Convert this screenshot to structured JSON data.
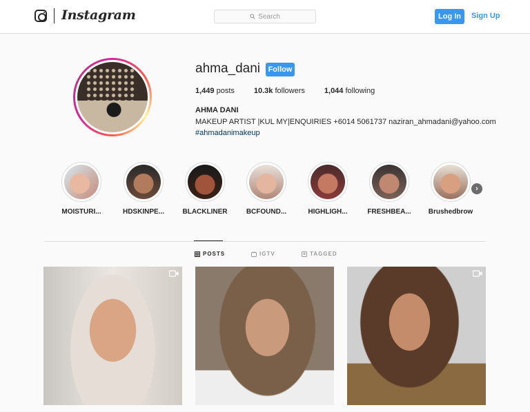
{
  "header": {
    "brand": "Instagram",
    "search_placeholder": "Search",
    "login_label": "Log In",
    "signup_label": "Sign Up"
  },
  "profile": {
    "username": "ahma_dani",
    "follow_label": "Follow",
    "stats": {
      "posts_count": "1,449",
      "posts_label": "posts",
      "followers_count": "10.3k",
      "followers_label": "followers",
      "following_count": "1,044",
      "following_label": "following"
    },
    "full_name": "AHMA DANI",
    "bio": "MAKEUP ARTIST |KUL MY|ENQUIRIES +6014 5061737 naziran_ahmadani@yahoo.com",
    "hashtag": "#ahmadanimakeup"
  },
  "highlights": [
    {
      "label": "MOISTURI..."
    },
    {
      "label": "HDSKINPE..."
    },
    {
      "label": "BLACKLINER"
    },
    {
      "label": "BCFOUND..."
    },
    {
      "label": "HIGHLIGH..."
    },
    {
      "label": "FRESHBEA..."
    },
    {
      "label": "Brushedbrow"
    }
  ],
  "tabs": {
    "posts": "POSTS",
    "igtv": "IGTV",
    "tagged": "TAGGED"
  },
  "colors": {
    "accent": "#3897f0",
    "link": "#003569"
  }
}
